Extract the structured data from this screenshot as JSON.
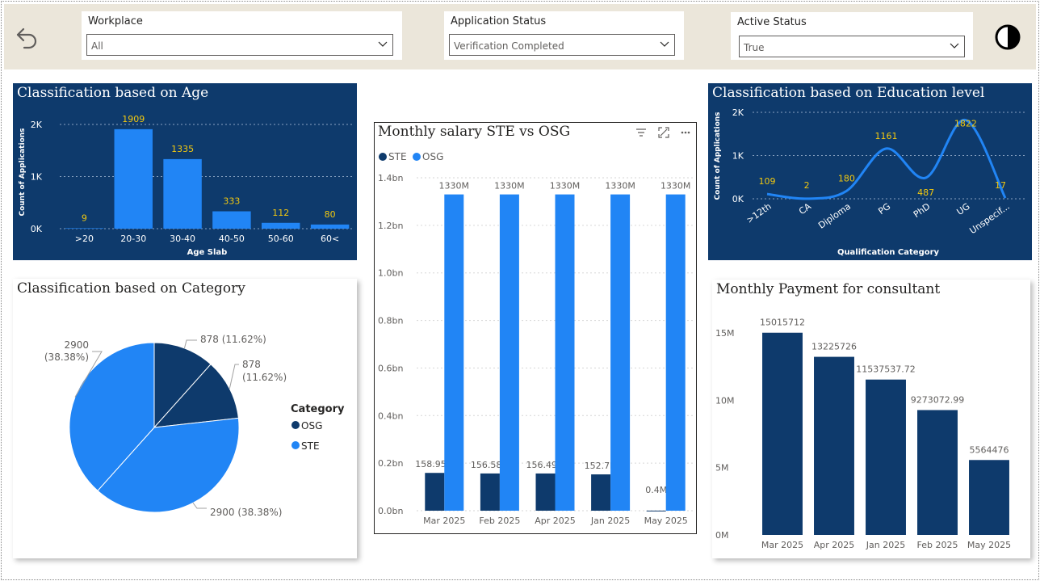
{
  "filters": {
    "workplace": {
      "label": "Workplace",
      "value": "All"
    },
    "application_status": {
      "label": "Application Status",
      "value": "Verification Completed"
    },
    "active_status": {
      "label": "Active Status",
      "value": "True"
    }
  },
  "toolbar": {
    "back_icon": "undo-arrow-icon",
    "theme_icon": "contrast-toggle-icon"
  },
  "colors": {
    "dark_navy": "#0e3a6c",
    "bright_blue": "#2185f5",
    "label_gold": "#f2c80f",
    "topbar": "#ebe6da"
  },
  "chart_data": [
    {
      "id": "age",
      "type": "bar",
      "title": "Classification based on Age",
      "xlabel": "Age Slab",
      "ylabel": "Count of Applications",
      "categories": [
        ">20",
        "20-30",
        "30-40",
        "40-50",
        "50-60",
        "60<"
      ],
      "values": [
        9,
        1909,
        1335,
        333,
        112,
        80
      ],
      "data_labels": [
        "9",
        "1909",
        "1335",
        "333",
        "112",
        "80"
      ],
      "yticks": [
        "0K",
        "1K",
        "2K"
      ],
      "ylim": [
        0,
        2000
      ],
      "grid": true
    },
    {
      "id": "education",
      "type": "line",
      "title": "Classification based on Education level",
      "xlabel": "Qualification Category",
      "ylabel": "Count of Applications",
      "categories": [
        ">12th",
        "CA",
        "Diploma",
        "PG",
        "PhD",
        "UG",
        "Unspecif..."
      ],
      "values": [
        109,
        2,
        180,
        1161,
        487,
        1822,
        17
      ],
      "data_labels": [
        "109",
        "2",
        "180",
        "1161",
        "487",
        "1822",
        "17"
      ],
      "yticks": [
        "0K",
        "1K",
        "2K"
      ],
      "ylim": [
        0,
        2000
      ],
      "grid": true
    },
    {
      "id": "category",
      "type": "pie",
      "title": "Classification based on Category",
      "legend_title": "Category",
      "legend_position": "right",
      "slices": [
        {
          "name": "OSG",
          "value": 878,
          "label": "878 (11.62%)",
          "color": "#0e3a6c"
        },
        {
          "name": "OSG",
          "value": 878,
          "label": "878 (11.62%)",
          "color": "#0e3a6c"
        },
        {
          "name": "STE",
          "value": 2900,
          "label": "2900 (38.38%)",
          "color": "#2185f5"
        },
        {
          "name": "STE",
          "value": 2900,
          "label": "2900 (38.38%)",
          "color": "#2185f5"
        }
      ],
      "legend": [
        {
          "name": "OSG",
          "color": "#0e3a6c"
        },
        {
          "name": "STE",
          "color": "#2185f5"
        }
      ]
    },
    {
      "id": "salary",
      "type": "bar",
      "title": "Monthly salary STE vs OSG",
      "legend_position": "top-left",
      "categories": [
        "Mar 2025",
        "Feb 2025",
        "Apr 2025",
        "Jan 2025",
        "May 2025"
      ],
      "series": [
        {
          "name": "STE",
          "color": "#0e3a6c",
          "values": [
            158.95,
            156.58,
            156.49,
            152.7,
            0.4
          ],
          "data_labels": [
            "158.95M",
            "156.58M",
            "156.49M",
            "152.7M",
            "0.4M"
          ]
        },
        {
          "name": "OSG",
          "color": "#2185f5",
          "values": [
            1330,
            1330,
            1330,
            1330,
            1330
          ],
          "data_labels": [
            "1330M",
            "1330M",
            "1330M",
            "1330M",
            "1330M"
          ]
        }
      ],
      "unit": "M",
      "yticks": [
        "0.0bn",
        "0.2bn",
        "0.4bn",
        "0.6bn",
        "0.8bn",
        "1.0bn",
        "1.2bn",
        "1.4bn"
      ],
      "ylim": [
        0,
        1400
      ],
      "grid": true
    },
    {
      "id": "consultant",
      "type": "bar",
      "title": "Monthly Payment for consultant",
      "categories": [
        "Mar 2025",
        "Apr 2025",
        "Jan 2025",
        "Feb 2025",
        "May 2025"
      ],
      "values": [
        15015712,
        13225726,
        11537537.72,
        9273072.99,
        5564476
      ],
      "data_labels": [
        "15015712",
        "13225726",
        "11537537.72",
        "9273072.99",
        "5564476"
      ],
      "yticks": [
        "0M",
        "5M",
        "10M",
        "15M"
      ],
      "ylim": [
        0,
        15000000
      ],
      "grid": false
    }
  ]
}
